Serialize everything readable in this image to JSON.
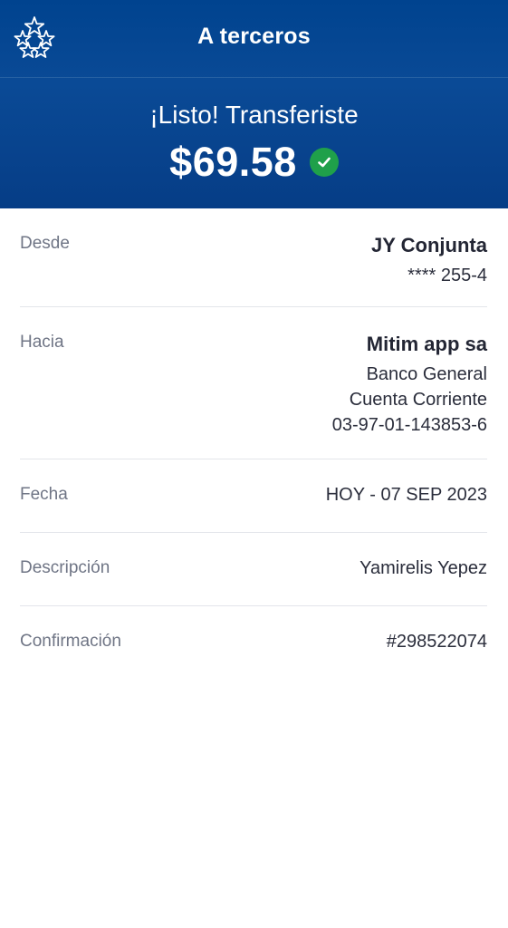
{
  "header": {
    "title": "A terceros",
    "logo_icon": "stars-logo-icon",
    "success_message": "¡Listo! Transferiste",
    "amount": "$69.58",
    "status_icon": "check-circle-icon",
    "status_color": "#1fa04a",
    "background_color": "#00438f"
  },
  "details": {
    "from": {
      "label": "Desde",
      "account_name": "JY Conjunta",
      "account_number": "**** 255-4"
    },
    "to": {
      "label": "Hacia",
      "recipient": "Mitim app sa",
      "bank": "Banco General",
      "account_type": "Cuenta Corriente",
      "account_number": "03-97-01-143853-6"
    },
    "date": {
      "label": "Fecha",
      "value": "HOY - 07 SEP 2023"
    },
    "description": {
      "label": "Descripción",
      "value": "Yamirelis Yepez"
    },
    "confirmation": {
      "label": "Confirmación",
      "value": "#298522074"
    }
  }
}
